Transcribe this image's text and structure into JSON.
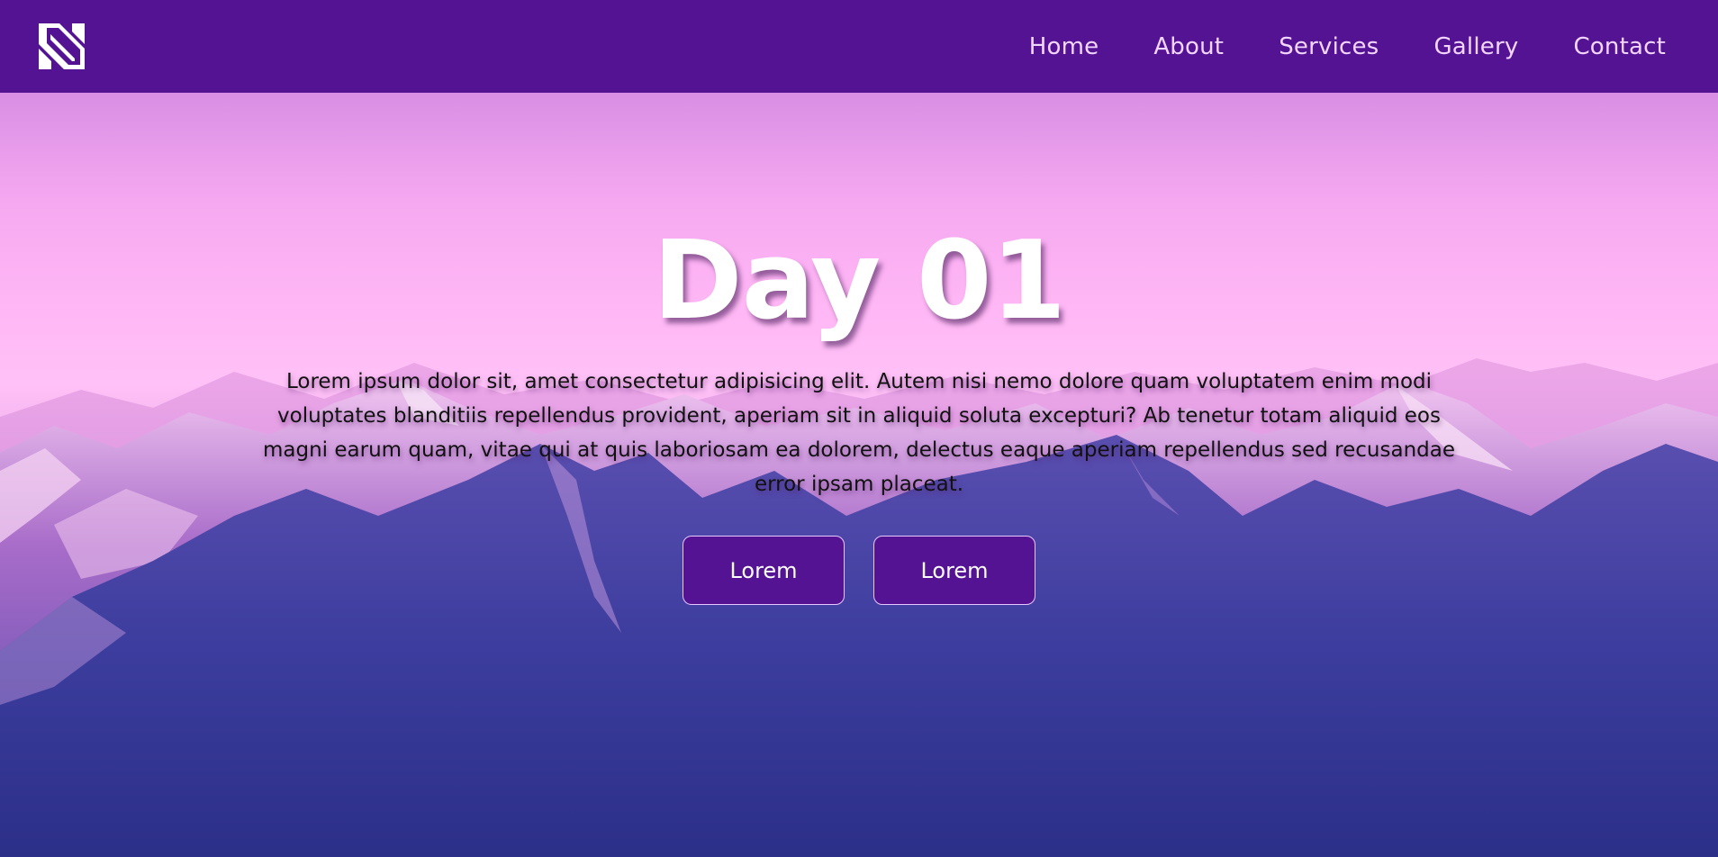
{
  "navbar": {
    "logo_icon": "n-logo-icon",
    "links": [
      {
        "label": "Home"
      },
      {
        "label": "About"
      },
      {
        "label": "Services"
      },
      {
        "label": "Gallery"
      },
      {
        "label": "Contact"
      }
    ]
  },
  "hero": {
    "title": "Day 01",
    "text": "Lorem ipsum dolor sit, amet consectetur adipisicing elit. Autem nisi nemo dolore quam voluptatem enim modi voluptates blanditiis repellendus provident, aperiam sit in aliquid soluta excepturi? Ab tenetur totam aliquid eos magni earum quam, vitae qui at quis laboriosam ea dolorem, delectus eaque aperiam repellendus sed recusandae error ipsam placeat.",
    "buttons": [
      {
        "label": "Lorem"
      },
      {
        "label": "Lorem"
      }
    ]
  },
  "colors": {
    "navbar_bg": "#541393",
    "nav_link": "#f3d6ff",
    "button_bg": "#541393",
    "title": "#ffffff"
  }
}
